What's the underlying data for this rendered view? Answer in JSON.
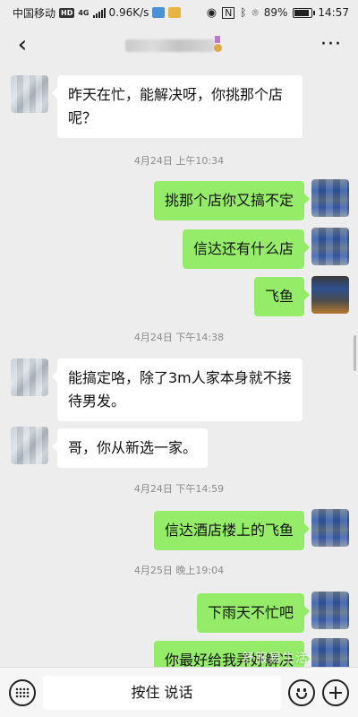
{
  "status_bar": {
    "carrier": "中国移动",
    "hd": "HD",
    "net_type": "4G",
    "speed": "0.96K/s",
    "battery": "89%",
    "time": "14:57"
  },
  "header": {
    "back_icon": "back-chevron-icon",
    "more_icon": "more-dots-icon"
  },
  "messages": [
    {
      "side": "in",
      "text": "昨天在忙，能解决呀，你挑那个店呢？"
    },
    {
      "type": "time",
      "text": "4月24日 上午10:34"
    },
    {
      "side": "out",
      "text": "挑那个店你又搞不定"
    },
    {
      "side": "out",
      "text": "信达还有什么店"
    },
    {
      "side": "out",
      "text": "飞鱼"
    },
    {
      "type": "time",
      "text": "4月24日 下午14:38"
    },
    {
      "side": "in",
      "text": "能搞定咯，除了3m人家本身就不接待男发。"
    },
    {
      "side": "in",
      "text": "哥，你从新选一家。"
    },
    {
      "type": "time",
      "text": "4月24日 下午14:59"
    },
    {
      "side": "out",
      "text": "信达酒店楼上的飞鱼"
    },
    {
      "type": "time",
      "text": "4月25日 晚上19:04"
    },
    {
      "side": "out",
      "text": "下雨天不忙吧"
    },
    {
      "side": "out",
      "text": "你最好给我弄好解决"
    }
  ],
  "bottom_bar": {
    "hold_to_talk": "按住 说话",
    "keyboard_icon": "keyboard-icon",
    "emoji_icon": "emoji-icon",
    "plus_icon": "plus-icon"
  },
  "watermark": "舒服易生活"
}
